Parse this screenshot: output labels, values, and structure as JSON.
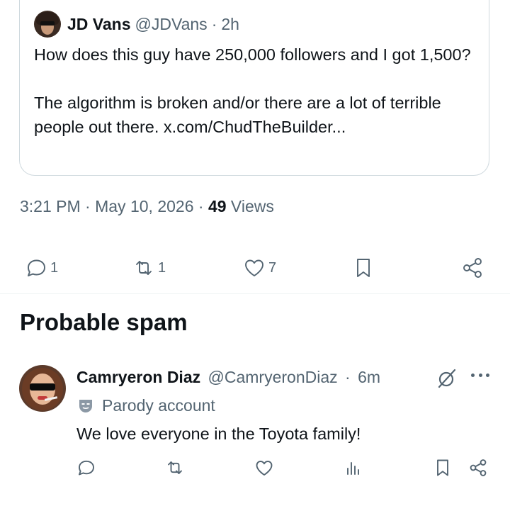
{
  "quote": {
    "author_name": "JD Vans",
    "author_handle": "@JDVans",
    "separator": "·",
    "age": "2h",
    "text_paragraph_1": "How does this guy have 250,000 followers and I got 1,500?",
    "text_paragraph_2": "The algorithm is broken and/or there are a lot of terrible people out there. x.com/ChudTheBuilder..."
  },
  "post": {
    "time": "3:21 PM",
    "date": "May 10, 2026",
    "views_count": "49",
    "views_label": "Views",
    "separator": "·"
  },
  "actions": {
    "replies": "1",
    "reposts": "1",
    "likes": "7"
  },
  "section": {
    "heading": "Probable spam"
  },
  "reply": {
    "author_name": "Camryeron Diaz",
    "author_handle": "@CamryeronDiaz",
    "separator": "·",
    "age": "6m",
    "badge_label": "Parody account",
    "text": "We love everyone in the Toyota family!"
  },
  "colors": {
    "text_primary": "#0f1419",
    "text_secondary": "#536471",
    "border": "#cfd9de"
  },
  "icons": {
    "reply": "reply-icon",
    "repost": "repost-icon",
    "like": "heart-icon",
    "bookmark": "bookmark-icon",
    "share": "share-icon",
    "grok": "grok-icon",
    "more": "more-icon",
    "analytics": "analytics-icon",
    "parody": "parody-mask-icon"
  }
}
